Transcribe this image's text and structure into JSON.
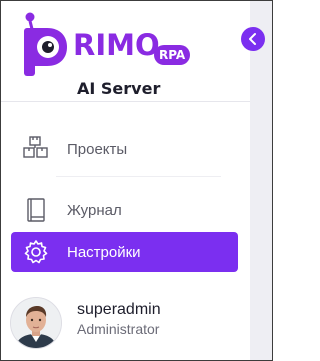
{
  "logo": {
    "wordmark": "RIMO",
    "badge": "RPA",
    "subtitle": "AI Server"
  },
  "sidebar": {
    "toggle_icon": "chevron-left-icon",
    "items": [
      {
        "label": "Проекты",
        "icon": "projects-icon",
        "active": false
      },
      {
        "label": "Журнал",
        "icon": "book-icon",
        "active": false
      },
      {
        "label": "Настройки",
        "icon": "gear-icon",
        "active": true
      }
    ]
  },
  "user": {
    "name": "superadmin",
    "role": "Administrator"
  },
  "colors": {
    "accent": "#7b2ff0",
    "brand": "#8a2be2",
    "text": "#1e1e2c",
    "muted": "#5b5b66"
  }
}
